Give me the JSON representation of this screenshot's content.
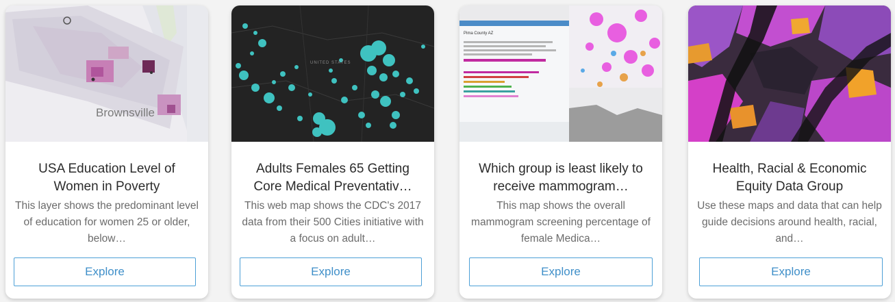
{
  "cards": [
    {
      "title": "USA Education Level of Women in Poverty",
      "description": "This layer shows the predominant level of education for women 25 or older, below…",
      "button": "Explore",
      "map_label": "Brownsville"
    },
    {
      "title": "Adults Females 65 Getting Core Medical Preventativ…",
      "description": "This web map shows the CDC's 2017 data from their 500 Cities initiative with a focus on adult…",
      "button": "Explore",
      "map_label": "UNITED STATES"
    },
    {
      "title": "Which group is least likely to receive mammogram…",
      "description": "This map shows the overall mammogram screening percentage of female Medica…",
      "button": "Explore",
      "popup_title": "Pima County AZ"
    },
    {
      "title": "Health, Racial & Economic Equity Data Group",
      "description": "Use these maps and data that can help guide decisions around health, racial, and…",
      "button": "Explore"
    }
  ],
  "colors": {
    "button_border": "#4c9fd6",
    "button_text": "#3f8fc9",
    "title_text": "#2b2b2b",
    "desc_text": "#6b6b6b"
  }
}
